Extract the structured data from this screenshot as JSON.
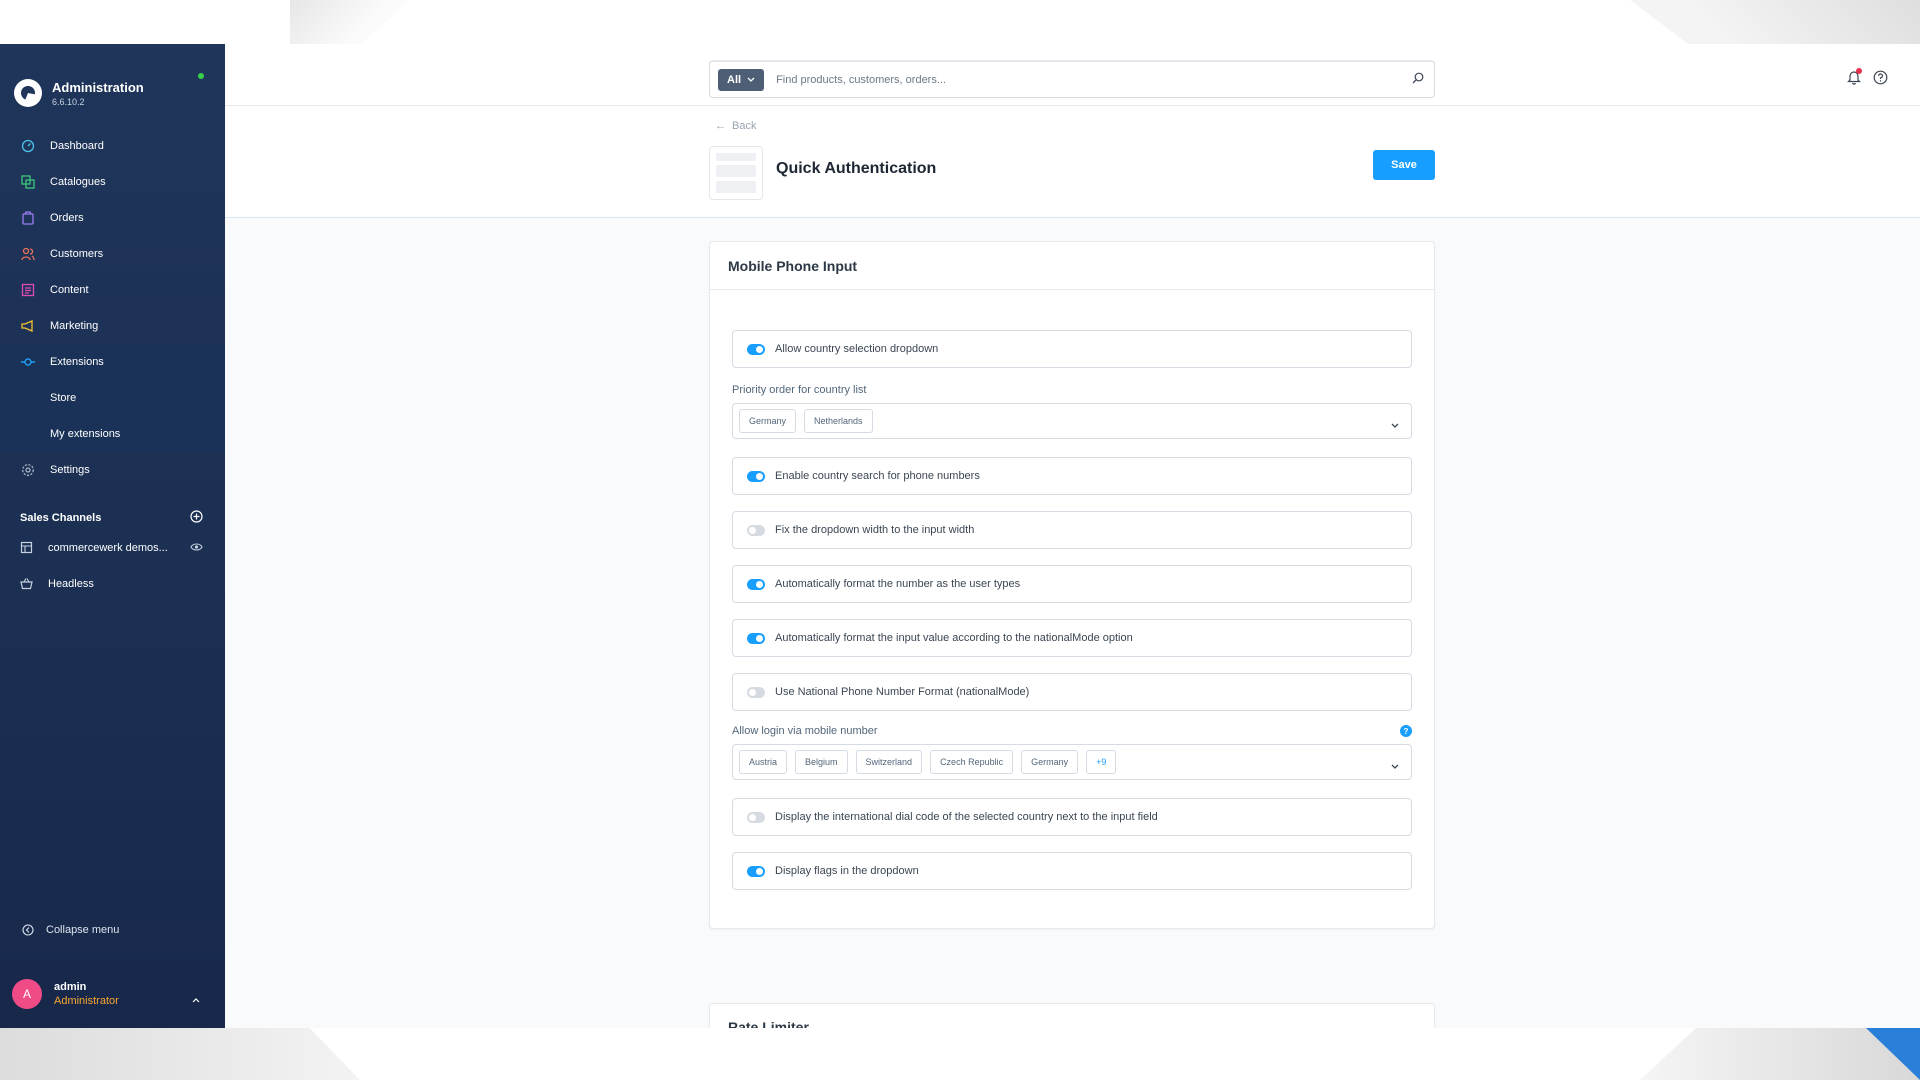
{
  "app": {
    "name": "Administration",
    "version": "6.6.10.2"
  },
  "sidebar": {
    "items": [
      {
        "label": "Dashboard",
        "icon": "gauge-icon",
        "color": "#4cc2e8"
      },
      {
        "label": "Catalogues",
        "icon": "catalogue-icon",
        "color": "#39c97a"
      },
      {
        "label": "Orders",
        "icon": "bag-icon",
        "color": "#9a7cf0"
      },
      {
        "label": "Customers",
        "icon": "users-icon",
        "color": "#f0735a"
      },
      {
        "label": "Content",
        "icon": "content-icon",
        "color": "#e04bb8"
      },
      {
        "label": "Marketing",
        "icon": "megaphone-icon",
        "color": "#f6c232"
      },
      {
        "label": "Extensions",
        "icon": "plug-icon",
        "color": "#1f9cf0"
      },
      {
        "label": "Settings",
        "icon": "gear-icon",
        "color": "#a7b3c3"
      }
    ],
    "extension_subitems": [
      "Store",
      "My extensions"
    ],
    "sales_channels_title": "Sales Channels",
    "sales_channels": [
      {
        "label": "commercewerk demos...",
        "icon": "storefront-icon"
      },
      {
        "label": "Headless",
        "icon": "basket-icon"
      }
    ],
    "collapse_label": "Collapse menu"
  },
  "user": {
    "initial": "A",
    "name": "admin",
    "role": "Administrator"
  },
  "search": {
    "scope": "All",
    "placeholder": "Find products, customers, orders..."
  },
  "header": {
    "back_label": "Back",
    "title": "Quick Authentication",
    "save_label": "Save"
  },
  "mobile_card": {
    "title": "Mobile Phone Input",
    "toggle1": {
      "label": "Allow country selection dropdown",
      "on": true
    },
    "priority_label": "Priority order for country list",
    "priority_countries": [
      "Germany",
      "Netherlands"
    ],
    "toggle2": {
      "label": "Enable country search for phone numbers",
      "on": true
    },
    "toggle3": {
      "label": "Fix the dropdown width to the input width",
      "on": false
    },
    "toggle4": {
      "label": "Automatically format the number as the user types",
      "on": true
    },
    "toggle5": {
      "label": "Automatically format the input value according to the nationalMode option",
      "on": true
    },
    "toggle6": {
      "label": "Use National Phone Number Format (nationalMode)",
      "on": false
    },
    "login_label": "Allow login via mobile number",
    "login_countries": [
      "Austria",
      "Belgium",
      "Switzerland",
      "Czech Republic",
      "Germany"
    ],
    "login_more": "+9",
    "toggle7": {
      "label": "Display the international dial code of the selected country next to the input field",
      "on": false
    },
    "toggle8": {
      "label": "Display flags in the dropdown",
      "on": true
    }
  },
  "rate_card": {
    "title": "Rate Limiter"
  },
  "colors": {
    "accent": "#189eff",
    "sidebar": "#1f355a",
    "online": "#37d046"
  }
}
